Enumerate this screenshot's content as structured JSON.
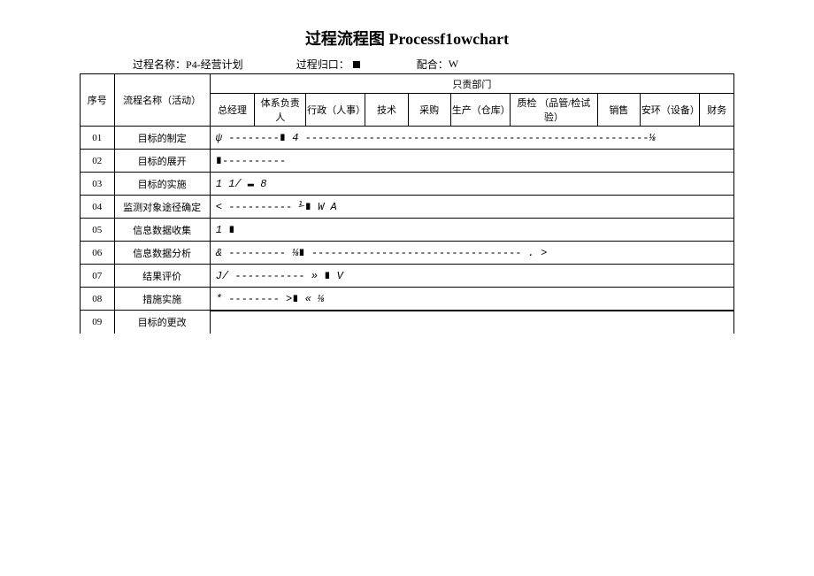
{
  "title": "过程流程图 Processf1owchart",
  "meta": {
    "process_name_label": "过程名称：",
    "process_name_value": "P4-经营计划",
    "process_owner_label": "过程归口：",
    "cooperate_label": "配合：",
    "cooperate_value": "W"
  },
  "headers": {
    "seq": "序号",
    "activity": "流程名称（活动）",
    "dept_group": "只责部门",
    "gm": "总经理",
    "system": "体系负责人",
    "admin": "行政（人事）",
    "tech": "技术",
    "purchase": "采购",
    "production": "生产（仓库）",
    "quality": "质检 （品管/检试验）",
    "sales": "销售",
    "safety": "安环（设备）",
    "finance": "财务"
  },
  "rows": [
    {
      "seq": "01",
      "activity": "目标的制定",
      "flow": "    ψ   --------∎       4 ------------------------------------------------------⅛"
    },
    {
      "seq": "02",
      "activity": "目标的展开",
      "flow": " ∎----------"
    },
    {
      "seq": "03",
      "activity": "目标的实施",
      "flow": "  1         1/   ▬   8"
    },
    {
      "seq": "04",
      "activity": "监测对象途径确定",
      "flow": " < ---------- ⅟∎         W                                                       A"
    },
    {
      "seq": "05",
      "activity": "信息数据收集",
      "flow": "  1             ∎"
    },
    {
      "seq": "06",
      "activity": "信息数据分析",
      "flow": " & --------- ⅛∎ --------------------------------- . >"
    },
    {
      "seq": "07",
      "activity": "结果评价",
      "flow": " J/ ----------- »  ∎    V"
    },
    {
      "seq": "08",
      "activity": "措施实施",
      "flow": " * -------- >∎ «                                                                  ⅛"
    },
    {
      "seq": "09",
      "activity": "目标的更改",
      "flow": ""
    }
  ]
}
